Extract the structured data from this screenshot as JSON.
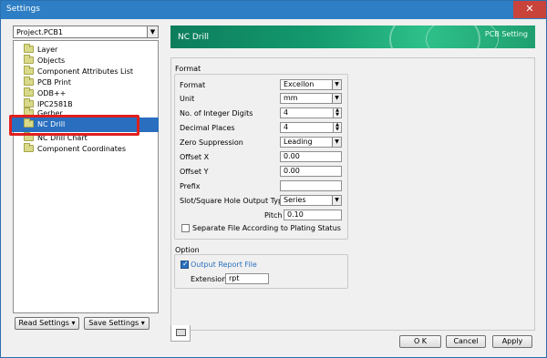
{
  "window": {
    "title": "Settings",
    "close_glyph": "✕"
  },
  "project": {
    "value": "Project.PCB1"
  },
  "tree": {
    "items": [
      {
        "label": "Layer"
      },
      {
        "label": "Objects"
      },
      {
        "label": "Component Attributes List"
      },
      {
        "label": "PCB Print"
      },
      {
        "label": "ODB++"
      },
      {
        "label": "IPC2581B"
      },
      {
        "label": "Gerber"
      },
      {
        "label": "NC Drill",
        "selected": true
      },
      {
        "label": "NC Drill Chart"
      },
      {
        "label": "Component Coordinates"
      }
    ]
  },
  "left_buttons": {
    "read_settings": "Read Settings",
    "save_settings": "Save Settings"
  },
  "header": {
    "title": "NC Drill",
    "subtitle": "PCB Setting"
  },
  "format_group": {
    "title": "Format",
    "fields": {
      "format": {
        "label": "Format",
        "value": "Excellon"
      },
      "unit": {
        "label": "Unit",
        "value": "mm"
      },
      "int_digits": {
        "label": "No. of Integer Digits",
        "value": "4"
      },
      "dec_places": {
        "label": "Decimal Places",
        "value": "4"
      },
      "zero_supp": {
        "label": "Zero Suppression",
        "value": "Leading"
      },
      "offset_x": {
        "label": "Offset X",
        "value": "0.00"
      },
      "offset_y": {
        "label": "Offset Y",
        "value": "0.00"
      },
      "prefix": {
        "label": "Prefix",
        "value": ""
      },
      "slot_type": {
        "label": "Slot/Square Hole Output Type",
        "value": "Series"
      },
      "pitch": {
        "label": "Pitch",
        "value": "0.10"
      }
    },
    "separate_file": {
      "label": "Separate File According to Plating Status",
      "checked": false
    }
  },
  "option_group": {
    "title": "Option",
    "output_report": {
      "label": "Output Report File",
      "checked": true
    },
    "extension": {
      "label": "Extension",
      "value": "rpt"
    }
  },
  "footer_buttons": {
    "ok": "O K",
    "cancel": "Cancel",
    "apply": "Apply"
  },
  "icons": {
    "folder": "folder-icon",
    "printer": "printer-icon"
  },
  "colors": {
    "accent": "#2a6fbf",
    "header_green": "#149a6e",
    "title_bar": "#2d7ec4",
    "highlight": "#e0201e"
  }
}
